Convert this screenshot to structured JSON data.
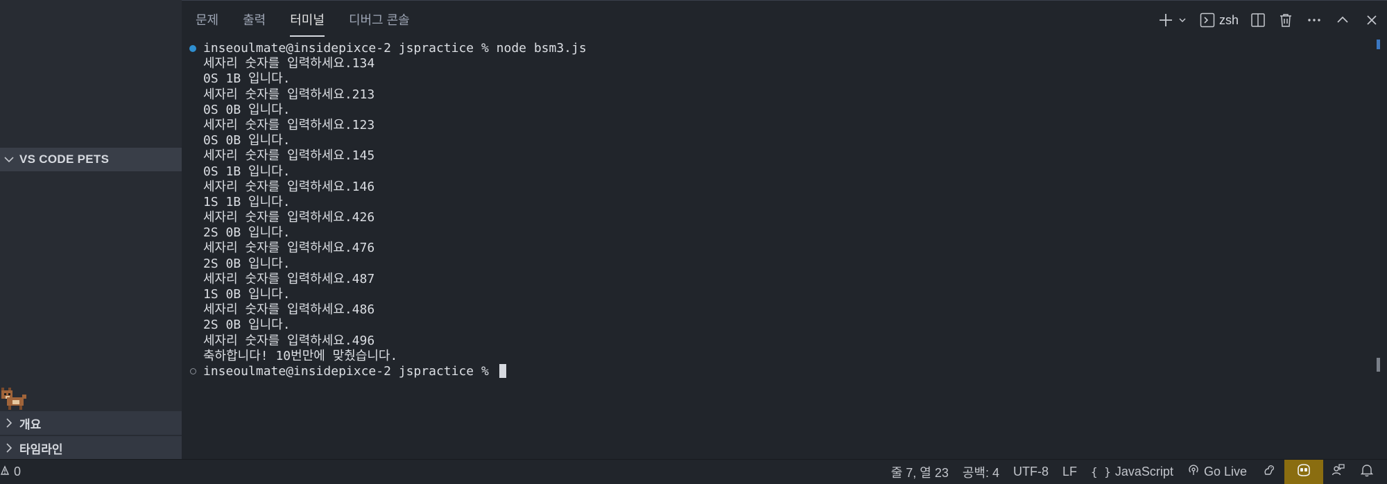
{
  "sidebar": {
    "pets_title": "VS CODE PETS",
    "sections": [
      {
        "label": "개요",
        "icon": "chevron-right-icon"
      },
      {
        "label": "타임라인",
        "icon": "chevron-right-icon"
      }
    ]
  },
  "panel": {
    "tabs": [
      {
        "label": "문제",
        "active": false
      },
      {
        "label": "출력",
        "active": false
      },
      {
        "label": "터미널",
        "active": true
      },
      {
        "label": "디버그 콘솔",
        "active": false
      }
    ],
    "actions": {
      "shell_label": "zsh",
      "icons": [
        "plus-icon",
        "chevron-down-icon",
        "terminal-icon",
        "split-icon",
        "trash-icon",
        "more-icon",
        "chevron-up-icon",
        "close-icon"
      ]
    }
  },
  "terminal": {
    "lines": [
      "inseoulmate@insidepixce-2 jspractice % node bsm3.js",
      "세자리 숫자를 입력하세요.134",
      "0S 1B 입니다.",
      "세자리 숫자를 입력하세요.213",
      "0S 0B 입니다.",
      "세자리 숫자를 입력하세요.123",
      "0S 0B 입니다.",
      "세자리 숫자를 입력하세요.145",
      "0S 1B 입니다.",
      "세자리 숫자를 입력하세요.146",
      "1S 1B 입니다.",
      "세자리 숫자를 입력하세요.426",
      "2S 0B 입니다.",
      "세자리 숫자를 입력하세요.476",
      "2S 0B 입니다.",
      "세자리 숫자를 입력하세요.487",
      "1S 0B 입니다.",
      "세자리 숫자를 입력하세요.486",
      "2S 0B 입니다.",
      "세자리 숫자를 입력하세요.496",
      "축하합니다! 10번만에 맞췄습니다.",
      "inseoulmate@insidepixce-2 jspractice % "
    ]
  },
  "statusbar": {
    "warnings": "0",
    "position": "줄 7, 열 23",
    "indent": "공백: 4",
    "encoding": "UTF-8",
    "eol": "LF",
    "language": "JavaScript",
    "golive": "Go Live"
  },
  "colors": {
    "accent_blue": "#2f8fd0",
    "status_highlight": "#8a6d10"
  }
}
